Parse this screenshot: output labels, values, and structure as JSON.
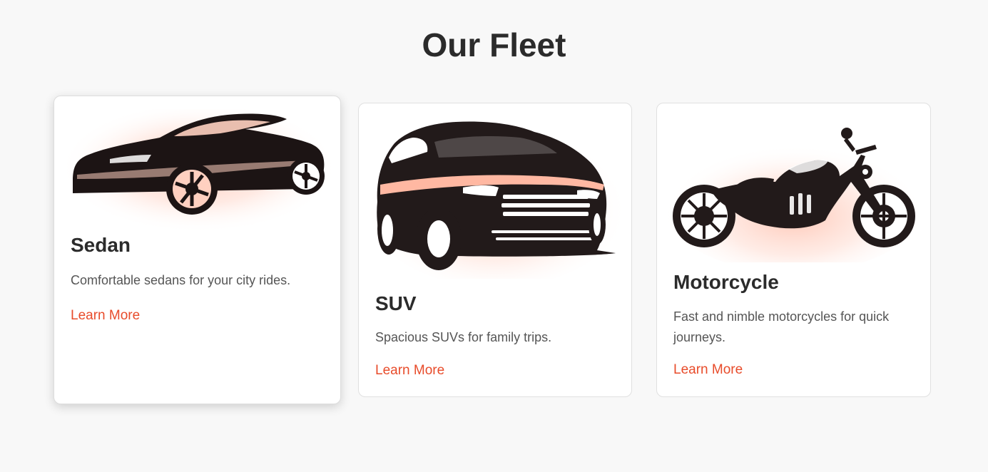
{
  "page": {
    "title": "Our Fleet"
  },
  "colors": {
    "background": "#f8f8f8",
    "card": "#ffffff",
    "accent": "#e84c2b",
    "glow": "#ffc4b2",
    "silhouette": "#1c1414"
  },
  "fleet": {
    "cards": [
      {
        "title": "Sedan",
        "description": "Comfortable sedans for your city rides.",
        "link_label": "Learn More",
        "icon": "sedan-car-icon"
      },
      {
        "title": "SUV",
        "description": "Spacious SUVs for family trips.",
        "link_label": "Learn More",
        "icon": "suv-car-icon"
      },
      {
        "title": "Motorcycle",
        "description": "Fast and nimble motorcycles for quick journeys.",
        "link_label": "Learn More",
        "icon": "motorcycle-icon"
      }
    ]
  }
}
